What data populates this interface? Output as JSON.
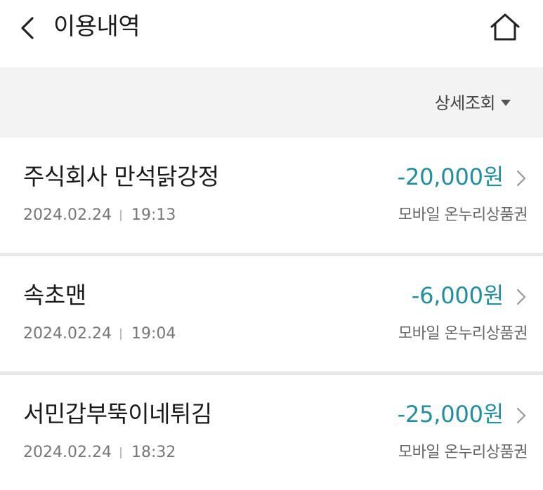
{
  "header": {
    "title": "이용내역",
    "back_icon": "chevron-left-icon",
    "home_icon": "home-icon"
  },
  "filter": {
    "label": "상세조회",
    "icon": "caret-down-icon"
  },
  "colors": {
    "amount": "#1f8fa3",
    "filter_bg": "#f3f3f3",
    "divider": "#e9e9e9"
  },
  "transactions": [
    {
      "merchant": "주식회사 만석닭강정",
      "date": "2024.02.24",
      "time": "19:13",
      "amount": "-20,000원",
      "method": "모바일 온누리상품권"
    },
    {
      "merchant": "속초맨",
      "date": "2024.02.24",
      "time": "19:04",
      "amount": "-6,000원",
      "method": "모바일 온누리상품권"
    },
    {
      "merchant": "서민갑부뚝이네튀김",
      "date": "2024.02.24",
      "time": "18:32",
      "amount": "-25,000원",
      "method": "모바일 온누리상품권"
    }
  ]
}
